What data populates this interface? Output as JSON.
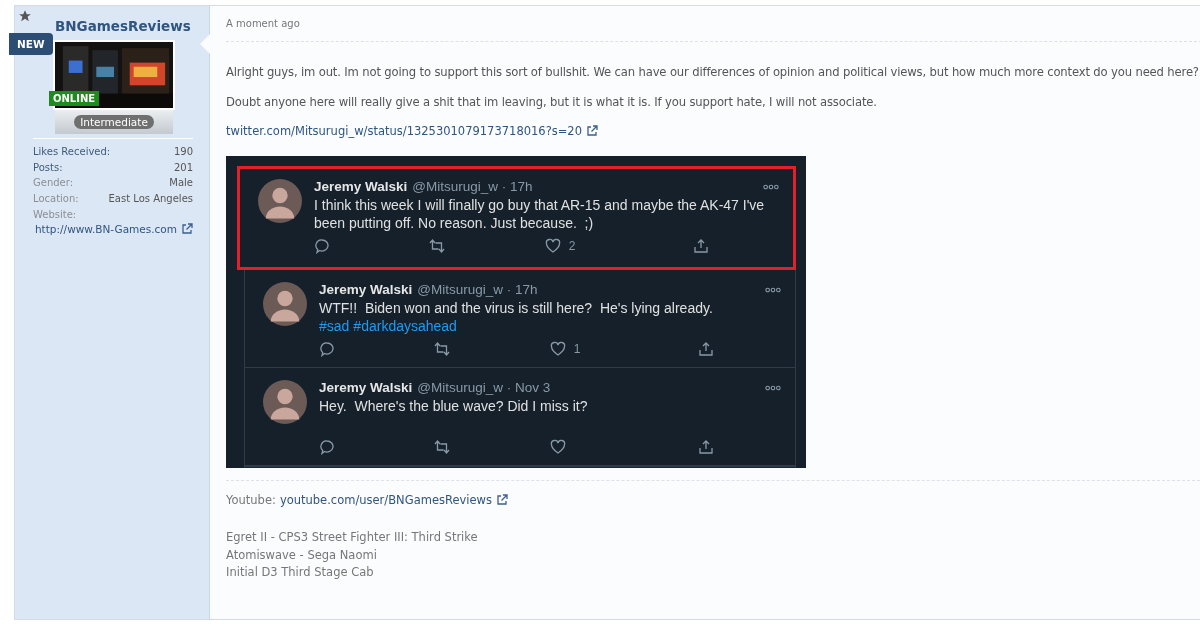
{
  "user": {
    "name": "BNGamesReviews",
    "ribbon": "NEW",
    "status": "ONLINE",
    "rank": "Intermediate",
    "stats": [
      {
        "label": "Likes Received:",
        "value": "190"
      },
      {
        "label": "Posts:",
        "value": "201"
      },
      {
        "label": "Gender:",
        "value": "Male"
      },
      {
        "label": "Location:",
        "value": "East Los Angeles"
      }
    ],
    "website": {
      "label": "Website:",
      "url": "http://www.BN-Games.com"
    }
  },
  "post": {
    "time": "A moment ago",
    "paragraphs": [
      "Alright guys, im out. Im not going to support this sort of bullshit. We can have our differences of opinion and political views, but how much more context do you need here?",
      "Doubt anyone here will really give a shit that im leaving, but it is what it is. If you support hate, I will not associate."
    ],
    "link": "twitter.com/Mitsurugi_w/status/1325301079173718016?s=20",
    "tweets": [
      {
        "author": "Jeremy Walski",
        "handle": "@Mitsurugi_w · 17h",
        "highlighted": true,
        "likes": "2",
        "text": [
          {
            "kind": "text",
            "text": "I think this week I will finally go buy that AR-15 and maybe the AK-47 I've been putting off. No reason. Just because.  ;)"
          }
        ]
      },
      {
        "author": "Jeremy Walski",
        "handle": "@Mitsurugi_w · 17h",
        "highlighted": false,
        "likes": "1",
        "text": [
          {
            "kind": "text",
            "text": "WTF!!  Biden won and the virus is still here?  He's lying already.  "
          },
          {
            "kind": "hashtag",
            "text": "#sad"
          },
          {
            "kind": "hashtag",
            "text": "#darkdaysahead"
          }
        ]
      },
      {
        "author": "Jeremy Walski",
        "handle": "@Mitsurugi_w · Nov 3",
        "highlighted": false,
        "text": [
          {
            "kind": "text",
            "text": "Hey.  Where's the blue wave? Did I miss it?"
          }
        ]
      }
    ]
  },
  "signature": {
    "youtube_label": "Youtube:",
    "youtube_link": "youtube.com/user/BNGamesReviews",
    "lines": [
      "Egret II - CPS3 Street Fighter III: Third Strike",
      "Atomiswave - Sega Naomi",
      "Initial D3 Third Stage Cab"
    ]
  }
}
